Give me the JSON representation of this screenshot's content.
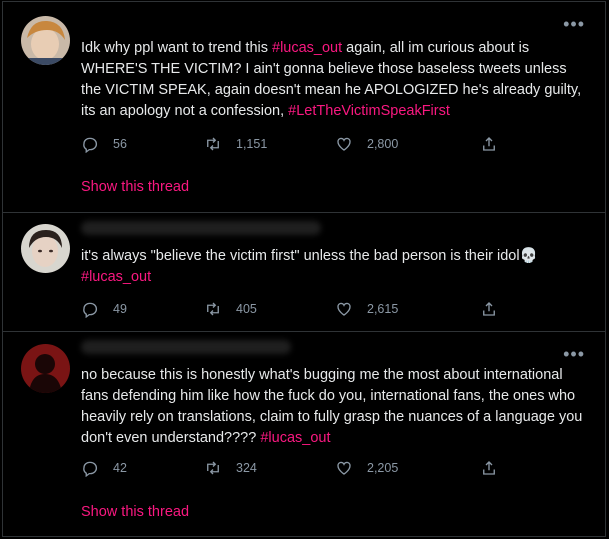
{
  "tweets": [
    {
      "parts": [
        {
          "t": "Idk why ppl want to trend this ",
          "h": false
        },
        {
          "t": "#lucas_out",
          "h": true
        },
        {
          "t": " again, all im curious about is WHERE'S THE VICTIM? I ain't gonna believe those baseless tweets unless the VICTIM SPEAK, again doesn't mean he APOLOGIZED he's already guilty, its an apology not a confession, ",
          "h": false
        },
        {
          "t": "#LetTheVictimSpeakFirst",
          "h": true
        }
      ],
      "replies": "56",
      "retweets": "1,151",
      "likes": "2,800",
      "show_thread": "Show this thread"
    },
    {
      "parts": [
        {
          "t": "it's always \"believe the victim first\" unless  the bad person is their idol💀 ",
          "h": false
        },
        {
          "t": "#lucas_out",
          "h": true
        }
      ],
      "replies": "49",
      "retweets": "405",
      "likes": "2,615"
    },
    {
      "parts": [
        {
          "t": "no because this is honestly what's bugging me the most about international fans defending him like how the fuck do you, international fans, the ones who heavily rely on translations, claim to fully grasp the nuances of a language you don't even understand???? ",
          "h": false
        },
        {
          "t": "#lucas_out",
          "h": true
        }
      ],
      "replies": "42",
      "retweets": "324",
      "likes": "2,205",
      "show_thread": "Show this thread"
    }
  ],
  "more_label": "•••",
  "colors": {
    "accent": "#f91880",
    "muted": "#8b98a5",
    "text": "#e7e9ea",
    "bg": "#000000"
  }
}
